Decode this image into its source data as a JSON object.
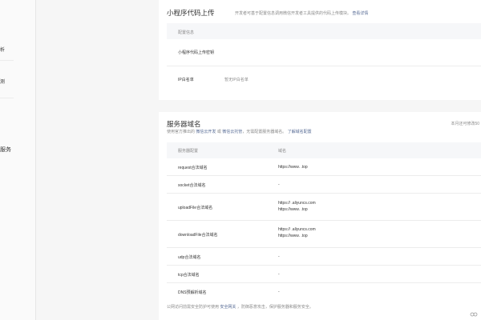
{
  "sidebar": {
    "items": [
      {
        "label": "析"
      },
      {
        "label": "测"
      },
      {
        "label": "服务"
      }
    ]
  },
  "upload": {
    "title": "小程序代码上传",
    "subtitle": "开发者可基于配置信息调用微信开发者工具提供的代码上传模块。",
    "subtitle_link": "查看详情",
    "config_header": "配置信息",
    "key_label": "小程序代码上传密钥",
    "ip_label": "IP白名单",
    "ip_value": "暂无IP白名单"
  },
  "servers": {
    "title": "服务器域名",
    "desc_prefix": "使用官方推出的",
    "link1": "微信云开发",
    "or_text": "或",
    "link2": "微信云托管",
    "desc_suffix": "，无需配置服务器域名。",
    "link3": "了解域名配置",
    "month_note": "本月还可修改50",
    "col1": "服务器配置",
    "col2": "域名",
    "rows": [
      {
        "name": "request合法域名",
        "values": [
          "https://www.  .top"
        ]
      },
      {
        "name": "socket合法域名",
        "values": [
          "-"
        ]
      },
      {
        "name": "uploadFile合法域名",
        "values": [
          "https://  .aliyuncs.com",
          "https://www.  .top"
        ]
      },
      {
        "name": "downloadFile合法域名",
        "values": [
          "https://  .aliyuncs.com",
          "https://www.  .top"
        ]
      },
      {
        "name": "udp合法域名",
        "values": [
          "-"
        ]
      },
      {
        "name": "tcp合法域名",
        "values": [
          "-"
        ]
      },
      {
        "name": "DNS预解析域名",
        "values": [
          "-"
        ]
      }
    ],
    "footer_prefix": "公网访问前需安全防护可使用",
    "footer_link": "安全网关",
    "footer_suffix": "，防御恶意攻击，保护服务器和服务安全。"
  }
}
